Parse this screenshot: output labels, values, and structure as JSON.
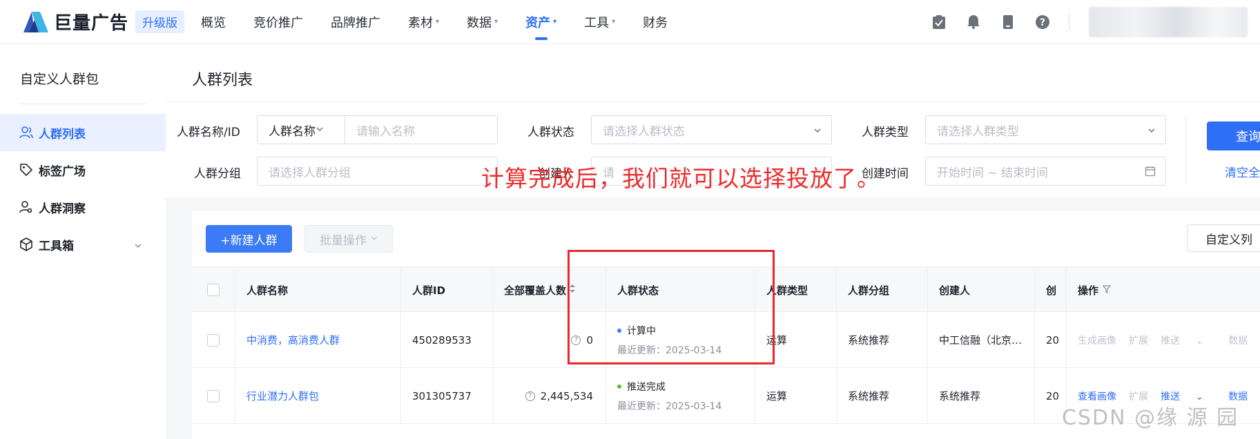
{
  "brand": {
    "name": "巨量广告",
    "badge": "升级版"
  },
  "nav": {
    "items": [
      {
        "label": "概览",
        "caret": ""
      },
      {
        "label": "竞价推广",
        "caret": ""
      },
      {
        "label": "品牌推广",
        "caret": ""
      },
      {
        "label": "素材",
        "caret": "▾"
      },
      {
        "label": "数据",
        "caret": "▾"
      },
      {
        "label": "资产",
        "caret": "▾"
      },
      {
        "label": "工具",
        "caret": "▾"
      },
      {
        "label": "财务",
        "caret": ""
      }
    ],
    "active": "资产"
  },
  "sidebar": {
    "title": "自定义人群包",
    "items": [
      {
        "label": "人群列表",
        "icon": "users-icon",
        "active": true
      },
      {
        "label": "标签广场",
        "icon": "tag-icon",
        "active": false
      },
      {
        "label": "人群洞察",
        "icon": "user-insight-icon",
        "active": false
      },
      {
        "label": "工具箱",
        "icon": "cube-icon",
        "active": false
      }
    ]
  },
  "page": {
    "title": "人群列表"
  },
  "filters": {
    "name_label": "人群名称/ID",
    "name_type": "人群名称",
    "name_placeholder": "请输入名称",
    "status_label": "人群状态",
    "status_placeholder": "请选择人群状态",
    "type_label": "人群类型",
    "type_placeholder": "请选择人群类型",
    "group_label": "人群分组",
    "group_placeholder": "请选择人群分组",
    "creator_label": "创建人",
    "creator_placeholder": "请",
    "time_label": "创建时间",
    "time_placeholder": "开始时间 ~ 结束时间",
    "query_button": "查询",
    "clear_link": "清空全"
  },
  "annotation": "计算完成后，我们就可以选择投放了。",
  "toolbar": {
    "new_button": "+新建人群",
    "batch_button": "批量操作",
    "columns_button": "自定义列"
  },
  "table": {
    "headers": [
      "人群名称",
      "人群ID",
      "全部覆盖人数",
      "人群状态",
      "人群类型",
      "人群分组",
      "创建人",
      "创",
      "操作"
    ],
    "rows": [
      {
        "name": "中消费，高消费人群",
        "id": "450289533",
        "coverage": "0",
        "status": "计算中",
        "status_color": "#3b7cf6",
        "updated": "最近更新：2025-03-14",
        "type": "运算",
        "group": "系统推荐",
        "creator": "中工信融（北京…",
        "created": "20",
        "ops": [
          "生成画像",
          "扩展",
          "推送",
          "数据"
        ],
        "ops_enabled": false
      },
      {
        "name": "行业潜力人群包",
        "id": "301305737",
        "coverage": "2,445,534",
        "status": "推送完成",
        "status_color": "#52c41a",
        "updated": "最近更新：2025-03-14",
        "type": "运算",
        "group": "系统推荐",
        "creator": "系统推荐",
        "created": "20",
        "ops": [
          "查看画像",
          "扩展",
          "推送",
          "数据"
        ],
        "ops_enabled": true
      }
    ]
  },
  "watermark": "CSDN @缘 源 园"
}
